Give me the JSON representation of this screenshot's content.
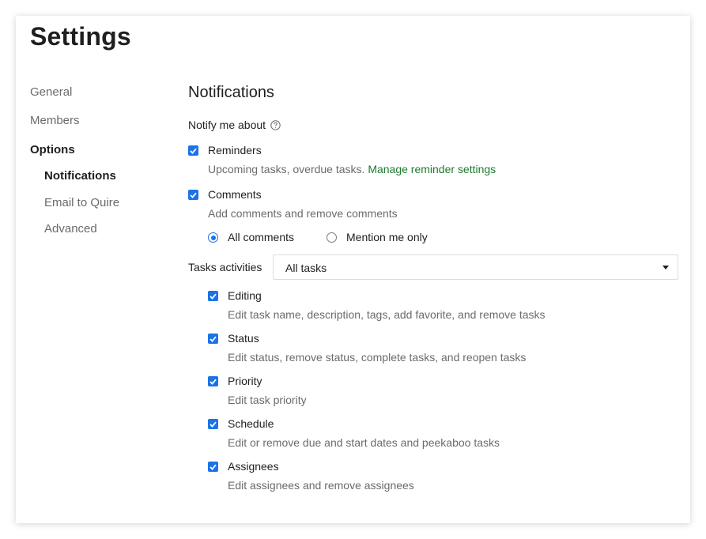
{
  "page_title": "Settings",
  "sidebar": {
    "items": [
      {
        "label": "General"
      },
      {
        "label": "Members"
      },
      {
        "label": "Options"
      },
      {
        "label": "Notifications"
      },
      {
        "label": "Email to Quire"
      },
      {
        "label": "Advanced"
      }
    ],
    "active": "Notifications"
  },
  "notifications": {
    "heading": "Notifications",
    "notify_label": "Notify me about",
    "help_icon": "question-circle-icon",
    "reminders": {
      "label": "Reminders",
      "checked": true,
      "description": "Upcoming tasks, overdue tasks.",
      "link": "Manage reminder settings"
    },
    "comments": {
      "label": "Comments",
      "checked": true,
      "description": "Add comments and remove comments",
      "options": [
        {
          "label": "All comments",
          "selected": true
        },
        {
          "label": "Mention me only",
          "selected": false
        }
      ]
    },
    "tasks_activities": {
      "label": "Tasks activities",
      "selected": "All tasks",
      "items": [
        {
          "label": "Editing",
          "checked": true,
          "description": "Edit task name, description, tags, add favorite, and remove tasks"
        },
        {
          "label": "Status",
          "checked": true,
          "description": "Edit status, remove status, complete tasks, and reopen tasks"
        },
        {
          "label": "Priority",
          "checked": true,
          "description": "Edit task priority"
        },
        {
          "label": "Schedule",
          "checked": true,
          "description": "Edit or remove due and start dates and peekaboo tasks"
        },
        {
          "label": "Assignees",
          "checked": true,
          "description": "Edit assignees and remove assignees"
        }
      ]
    }
  },
  "colors": {
    "accent": "#1a73e8",
    "link": "#1e7a2e",
    "muted_text": "#6b6b6b"
  }
}
